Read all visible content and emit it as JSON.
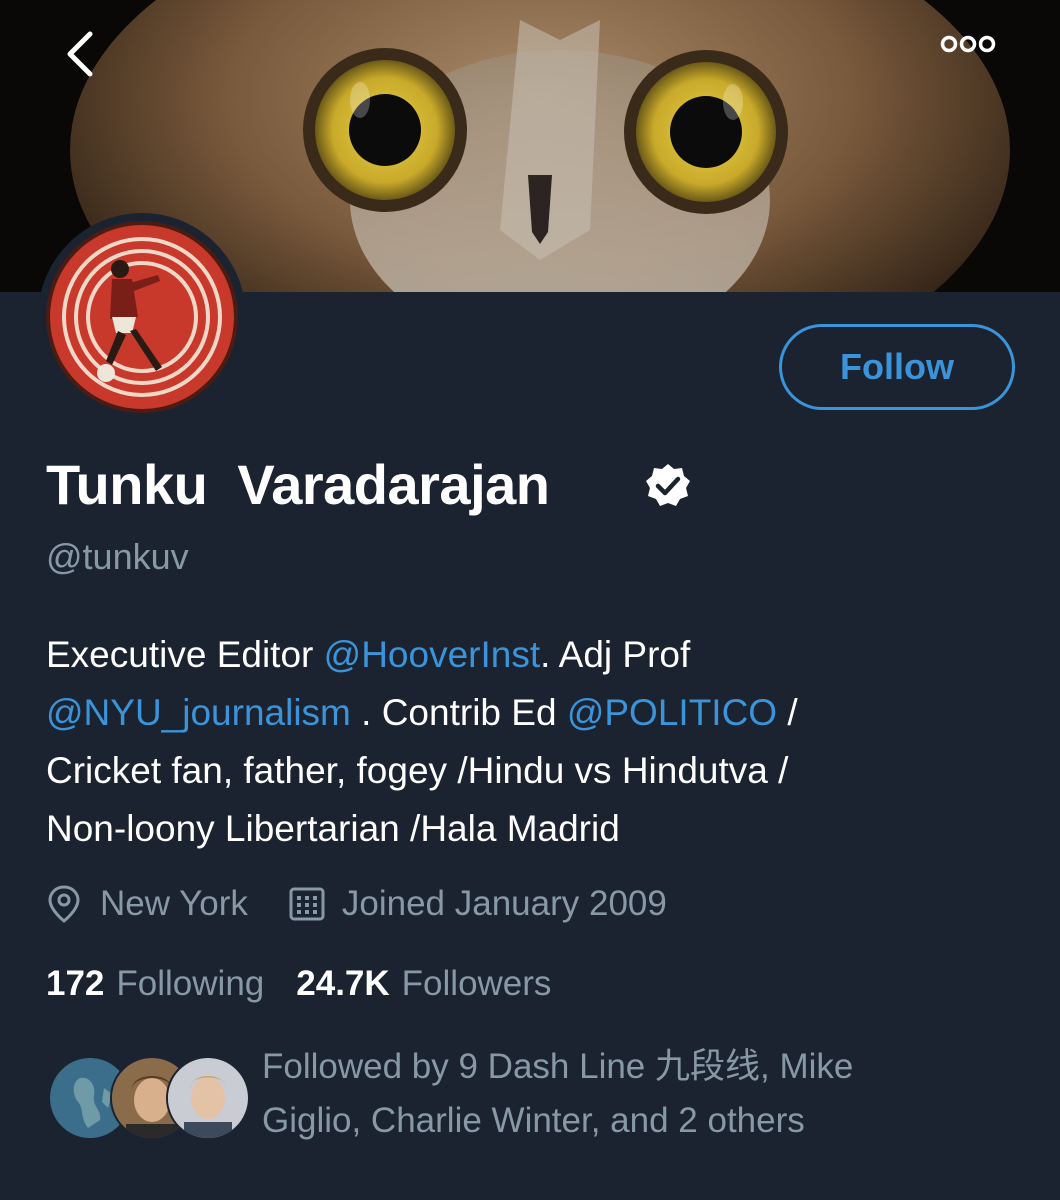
{
  "header": {
    "back_icon": "chevron-left-icon",
    "more_icon": "more-horizontal-icon"
  },
  "profile": {
    "display_name": "Tunku  Varadarajan",
    "verified": true,
    "handle": "@tunkuv",
    "follow_label": "Follow",
    "bio": {
      "line1_text1": "Executive Editor ",
      "line1_mention1": "@HooverInst",
      "line1_text2": ". Adj Prof",
      "line2_mention1": "@NYU_journalism",
      "line2_text1": " . Contrib Ed ",
      "line2_mention2": "@POLITICO",
      "line2_text2": " /",
      "line3": "Cricket fan, father, fogey /Hindu vs Hindutva /",
      "line4": "Non-loony Libertarian /Hala Madrid"
    },
    "location": "New York",
    "joined": "Joined January 2009"
  },
  "stats": {
    "following_count": "172",
    "following_label": "Following",
    "followers_count": "24.7K",
    "followers_label": "Followers"
  },
  "followed_by": {
    "line1": "Followed by 9 Dash Line 九段线, Mike",
    "line2": "Giglio, Charlie Winter, and 2 others"
  },
  "colors": {
    "background": "#1b2330",
    "accent": "#3b94d9",
    "secondary_text": "#8899a6"
  }
}
